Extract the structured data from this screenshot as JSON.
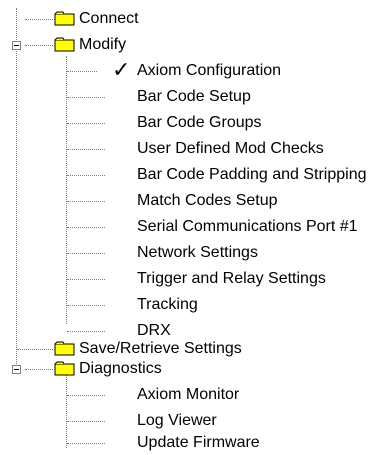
{
  "tree": {
    "nodes": [
      {
        "label": "Connect",
        "icon": "folder-icon",
        "level": 0
      },
      {
        "label": "Modify",
        "icon": "folder-icon",
        "level": 0,
        "expanded": true
      },
      {
        "label": "Axiom Configuration",
        "icon": "checkmark-icon",
        "level": 1
      },
      {
        "label": "Bar Code Setup",
        "level": 1
      },
      {
        "label": "Bar Code Groups",
        "level": 1
      },
      {
        "label": "User Defined Mod Checks",
        "level": 1
      },
      {
        "label": "Bar Code Padding and Stripping",
        "level": 1
      },
      {
        "label": "Match Codes Setup",
        "level": 1
      },
      {
        "label": "Serial Communications Port #1",
        "level": 1
      },
      {
        "label": "Network Settings",
        "level": 1
      },
      {
        "label": "Trigger and Relay Settings",
        "level": 1
      },
      {
        "label": "Tracking",
        "level": 1
      },
      {
        "label": "DRX",
        "level": 1
      },
      {
        "label": "Save/Retrieve Settings",
        "icon": "folder-icon",
        "level": 0
      },
      {
        "label": "Diagnostics",
        "icon": "folder-icon",
        "level": 0,
        "expanded": true
      },
      {
        "label": "Axiom Monitor",
        "level": 1
      },
      {
        "label": "Log Viewer",
        "level": 1
      },
      {
        "label": "Update Firmware",
        "level": 1
      }
    ]
  },
  "colors": {
    "folder_fill": "#ffff00",
    "folder_outline": "#000000",
    "connector": "#808080"
  }
}
